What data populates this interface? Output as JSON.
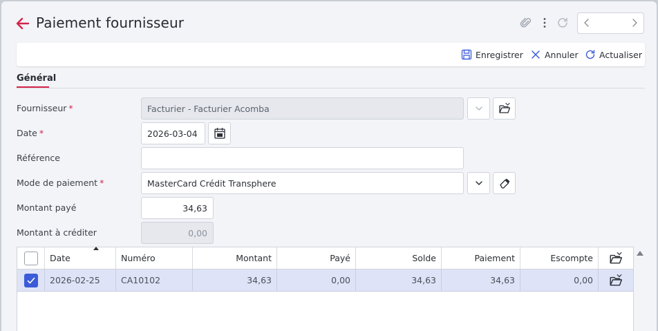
{
  "header": {
    "title": "Paiement fournisseur",
    "icons": [
      "back-arrow-icon",
      "paperclip-icon",
      "more-vertical-icon",
      "refresh-icon",
      "chevron-left-icon",
      "chevron-right-icon"
    ],
    "accent_color": "#d4234a"
  },
  "toolbar": {
    "save_label": "Enregistrer",
    "cancel_label": "Annuler",
    "refresh_label": "Actualiser"
  },
  "tabs": [
    {
      "label": "Général",
      "active": true
    }
  ],
  "form": {
    "supplier": {
      "label": "Fournisseur",
      "required": "*",
      "value": "Facturier - Facturier Acomba"
    },
    "date": {
      "label": "Date",
      "required": "*",
      "value": "2026-03-04"
    },
    "reference": {
      "label": "Référence",
      "value": ""
    },
    "payment_mode": {
      "label": "Mode de paiement",
      "required": "*",
      "value": "MasterCard Crédit Transphere"
    },
    "amount_paid": {
      "label": "Montant payé",
      "value": "34,63"
    },
    "amount_credit": {
      "label": "Montant à créditer",
      "value": "0,00"
    }
  },
  "grid": {
    "columns": [
      "Date",
      "Numéro",
      "Montant",
      "Payé",
      "Solde",
      "Paiement",
      "Escompte"
    ],
    "rows": [
      {
        "checked": true,
        "date": "2026-02-25",
        "number": "CA10102",
        "amount": "34,63",
        "paid": "0,00",
        "balance": "34,63",
        "payment": "34,63",
        "discount": "0,00"
      }
    ],
    "selected_row_color": "#dfe3f7",
    "checkbox_color": "#3b5bd9"
  }
}
